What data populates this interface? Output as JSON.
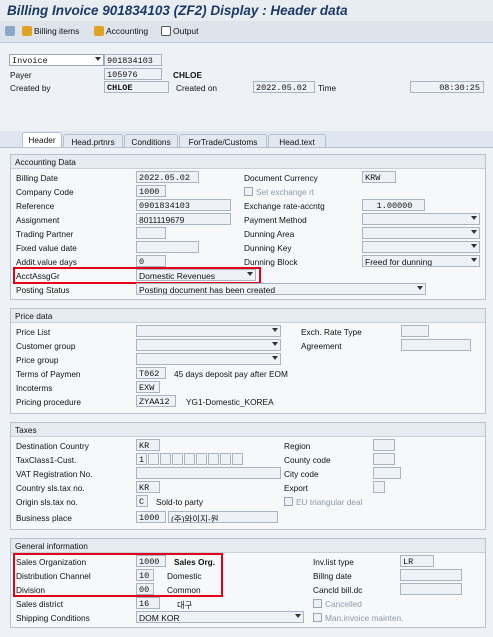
{
  "title": "Billing Invoice 901834103 (ZF2) Display : Header data",
  "toolbar": {
    "billing_items": "Billing items",
    "accounting": "Accounting",
    "output": "Output"
  },
  "header": {
    "doc_type": "Invoice",
    "doc_number": "901834103",
    "payer_label": "Payer",
    "payer": "105976",
    "payer_name": "CHLOE",
    "created_by_label": "Created by",
    "created_by": "CHLOE",
    "created_on_label": "Created on",
    "created_on": "2022.05.02",
    "time_label": "Time",
    "time": "08:30:25"
  },
  "tabs": [
    "Header",
    "Head.prtnrs",
    "Conditions",
    "ForTrade/Customs",
    "Head.text"
  ],
  "accounting": {
    "title": "Accounting Data",
    "billing_date_label": "Billing Date",
    "billing_date": "2022.05.02",
    "company_code_label": "Company Code",
    "company_code": "1000",
    "reference_label": "Reference",
    "reference": "0901834103",
    "assignment_label": "Assignment",
    "assignment": "8011119679",
    "trading_partner_label": "Trading Partner",
    "fixed_value_date_label": "Fixed value date",
    "addit_value_days_label": "Addit.value days",
    "addit_value_days": "0",
    "acct_assg_gr_label": "AcctAssgGr",
    "acct_assg_gr": "Domestic Revenues",
    "posting_status_label": "Posting Status",
    "posting_status": "Posting document has been created",
    "doc_currency_label": "Document Currency",
    "doc_currency": "KRW",
    "set_exchange_rt_label": "Set exchange rt",
    "exchange_rate_label": "Exchange rate-accntg",
    "exchange_rate": "1.00000",
    "payment_method_label": "Payment Method",
    "dunning_area_label": "Dunning Area",
    "dunning_key_label": "Dunning Key",
    "dunning_block_label": "Dunning Block",
    "dunning_block": "Freed for dunning"
  },
  "price": {
    "title": "Price data",
    "price_list_label": "Price List",
    "customer_group_label": "Customer group",
    "price_group_label": "Price group",
    "terms_label": "Terms of Paymen",
    "terms": "T062",
    "terms_text": "45 days deposit pay after EOM",
    "incoterms_label": "Incoterms",
    "incoterms": "EXW",
    "pricing_label": "Pricing procedure",
    "pricing": "ZYAA12",
    "pricing_text": "YG1-Domestic_KOREA",
    "exch_rate_type_label": "Exch. Rate Type",
    "agreement_label": "Agreement"
  },
  "taxes": {
    "title": "Taxes",
    "dest_country_label": "Destination Country",
    "dest_country": "KR",
    "taxclass_label": "TaxClass1-Cust.",
    "taxclass": "1",
    "vat_label": "VAT Registration No.",
    "country_sls_label": "Country sls.tax no.",
    "country_sls": "KR",
    "origin_label": "Origin sls.tax no.",
    "origin": "C",
    "origin_text": "Sold-to party",
    "business_place_label": "Business place",
    "business_place": "1000",
    "business_place_text": "(주)와이지-원",
    "region_label": "Region",
    "county_label": "County code",
    "city_label": "City code",
    "export_label": "Export",
    "eu_label": "EU triangular deal"
  },
  "general": {
    "title": "General information",
    "sales_org_label": "Sales Organization",
    "sales_org": "1000",
    "sales_org_text": "Sales Org.",
    "dist_channel_label": "Distribution Channel",
    "dist_channel": "10",
    "dist_channel_text": "Domestic",
    "division_label": "Division",
    "division": "00",
    "division_text": "Common",
    "sales_district_label": "Sales district",
    "sales_district": "16",
    "sales_district_text": "대구",
    "shipping_label": "Shipping Conditions",
    "shipping": "DOM KOR",
    "inv_list_type_label": "Inv.list type",
    "inv_list_type": "LR",
    "billing_date_label": "Billng date",
    "cancld_label": "Cancld bill.dc",
    "cancelled_label": "Cancelled",
    "man_invoice_label": "Man.invoice mainten."
  },
  "colors": {
    "highlight": "#e2001a",
    "title": "#1c3a68"
  }
}
